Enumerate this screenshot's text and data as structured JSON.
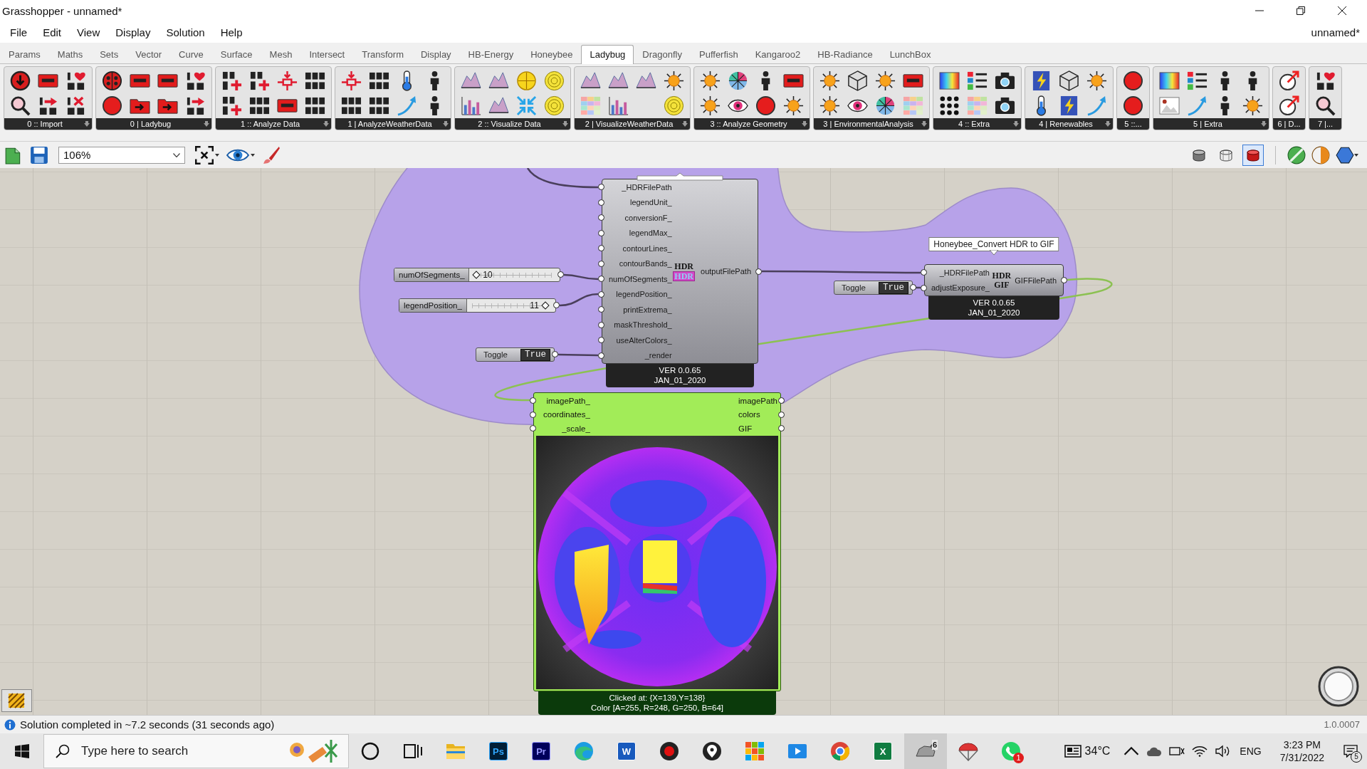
{
  "window": {
    "title": "Grasshopper - unnamed*",
    "document": "unnamed*"
  },
  "menu": [
    "File",
    "Edit",
    "View",
    "Display",
    "Solution",
    "Help"
  ],
  "tabs": [
    {
      "label": "Params",
      "selected": false
    },
    {
      "label": "Maths",
      "selected": false
    },
    {
      "label": "Sets",
      "selected": false
    },
    {
      "label": "Vector",
      "selected": false
    },
    {
      "label": "Curve",
      "selected": false
    },
    {
      "label": "Surface",
      "selected": false
    },
    {
      "label": "Mesh",
      "selected": false
    },
    {
      "label": "Intersect",
      "selected": false
    },
    {
      "label": "Transform",
      "selected": false
    },
    {
      "label": "Display",
      "selected": false
    },
    {
      "label": "HB-Energy",
      "selected": false
    },
    {
      "label": "Honeybee",
      "selected": false
    },
    {
      "label": "Ladybug",
      "selected": true
    },
    {
      "label": "Dragonfly",
      "selected": false
    },
    {
      "label": "Pufferfish",
      "selected": false
    },
    {
      "label": "Kangaroo2",
      "selected": false
    },
    {
      "label": "HB-Radiance",
      "selected": false
    },
    {
      "label": "LunchBox",
      "selected": false
    }
  ],
  "ribbon_groups": [
    {
      "label": "0 :: Import"
    },
    {
      "label": "0 | Ladybug"
    },
    {
      "label": "1 :: Analyze Data"
    },
    {
      "label": "1 | AnalyzeWeatherData"
    },
    {
      "label": "2 :: Visualize Data"
    },
    {
      "label": "2 | VisualizeWeatherData"
    },
    {
      "label": "3 :: Analyze Geometry"
    },
    {
      "label": "3 | EnvironmentalAnalysis"
    },
    {
      "label": "4 :: Extra"
    },
    {
      "label": "4 | Renewables"
    },
    {
      "label": "5 ::..."
    },
    {
      "label": "5 | Extra"
    },
    {
      "label": "6 | D..."
    },
    {
      "label": "7 |..."
    }
  ],
  "canvas_toolbar": {
    "zoom": "106%",
    "preview_modes": [
      {
        "selected": false
      },
      {
        "selected": false
      },
      {
        "selected": true
      }
    ]
  },
  "canvas": {
    "components": [
      {
        "inputs": [
          "_HDRFilePath",
          "legendUnit_",
          "conversionF_",
          "legendMax_",
          "contourLines_",
          "contourBands_",
          "numOfSegments_",
          "legendPosition_",
          "printExtrema_",
          "maskThreshold_",
          "useAlterColors_",
          "_render"
        ],
        "outputs": [
          "outputFilePath"
        ],
        "icon_text": [
          "HDR",
          "HDR"
        ],
        "footer": [
          "VER 0.0.65",
          "JAN_01_2020"
        ]
      },
      {
        "tooltip": "Honeybee_Convert HDR to GIF",
        "inputs": [
          "_HDRFilePath",
          "adjustExposure_"
        ],
        "outputs": [
          "GIFFilePath"
        ],
        "icon_text": [
          "HDR",
          "GIF"
        ],
        "footer": [
          "VER 0.0.65",
          "JAN_01_2020"
        ]
      }
    ],
    "sliders": [
      {
        "name": "numOfSegments_",
        "value": "10",
        "level": 0.03
      },
      {
        "name": "legendPosition_",
        "value": "11",
        "level": 0.97
      }
    ],
    "toggles": [
      {
        "label": "Toggle",
        "value": "True"
      },
      {
        "label": "Toggle",
        "value": "True"
      }
    ],
    "viewer": {
      "inputs": [
        "imagePath_",
        "coordinates_",
        "_scale_"
      ],
      "outputs": [
        "imagePath",
        "colors",
        "GIF"
      ],
      "footer": [
        "Clicked at: {X=139,Y=138}",
        "Color [A=255, R=248, G=250, B=64]"
      ]
    }
  },
  "status_bar": {
    "message": "Solution completed in ~7.2 seconds (31 seconds ago)",
    "version": "1.0.0007"
  },
  "taskbar": {
    "search": {
      "placeholder": "Type here to search"
    },
    "apps": [
      {
        "kind": "cortana",
        "selected": false
      },
      {
        "kind": "task_view",
        "selected": false
      },
      {
        "kind": "explorer",
        "selected": false
      },
      {
        "kind": "photoshop",
        "label": "Ps",
        "selected": false
      },
      {
        "kind": "premiere",
        "label": "Pr",
        "selected": false
      },
      {
        "kind": "edge",
        "selected": false
      },
      {
        "kind": "word",
        "label": "W",
        "selected": false
      },
      {
        "kind": "recorder",
        "selected": false
      },
      {
        "kind": "pin",
        "selected": false
      },
      {
        "kind": "store",
        "selected": false
      },
      {
        "kind": "video",
        "selected": false
      },
      {
        "kind": "chrome",
        "selected": false
      },
      {
        "kind": "excel",
        "label": "X",
        "selected": false
      },
      {
        "kind": "rhino",
        "badge": "6",
        "selected": true
      },
      {
        "kind": "parachute",
        "selected": false
      },
      {
        "kind": "whatsapp",
        "badge": "1",
        "selected": false
      }
    ],
    "weather": "34°C",
    "language": "ENG",
    "time": "3:23 PM",
    "date": "7/31/2022",
    "notifications": "5"
  }
}
